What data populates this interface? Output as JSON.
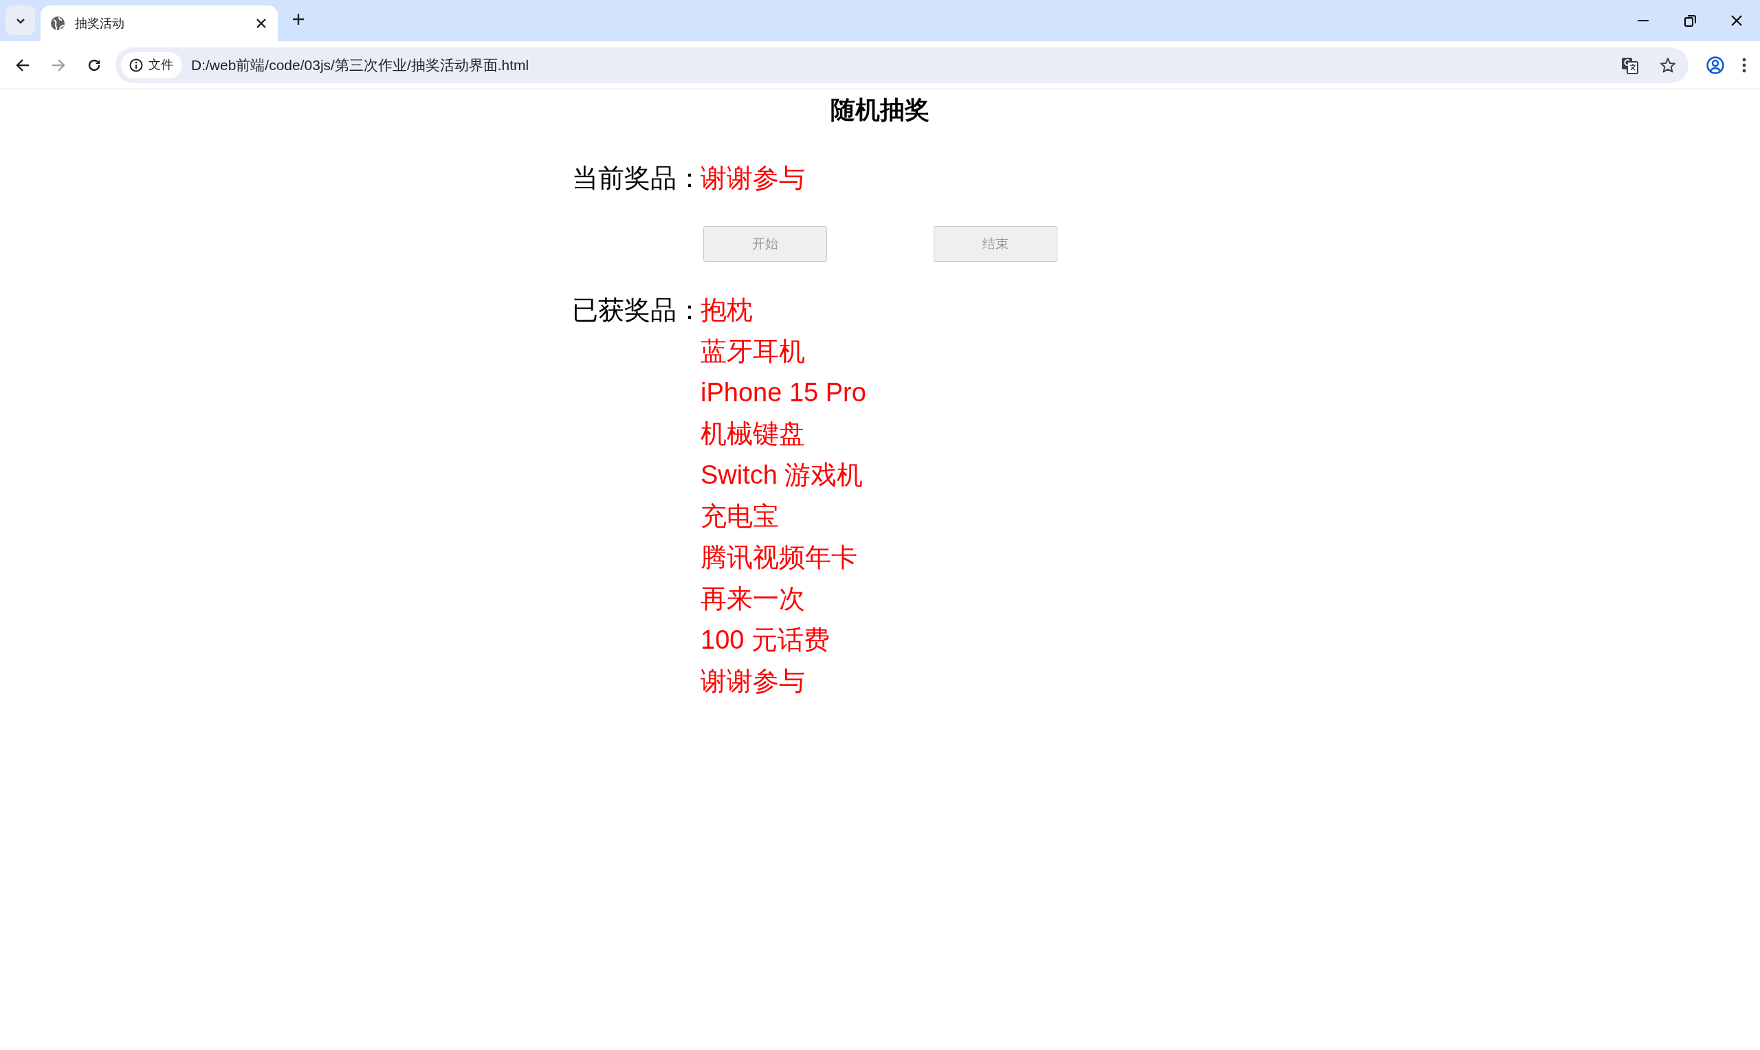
{
  "browser": {
    "tab": {
      "title": "抽奖活动",
      "selected": true
    },
    "security_chip": "文件",
    "url": "D:/web前端/code/03js/第三次作业/抽奖活动界面.html"
  },
  "page": {
    "title": "随机抽奖",
    "current_label": "当前奖品：",
    "current_prize": "谢谢参与",
    "buttons": [
      {
        "label": "开始",
        "disabled": true
      },
      {
        "label": "结束",
        "disabled": true
      }
    ],
    "won_label": "已获奖品：",
    "won_prizes": [
      "抱枕",
      "蓝牙耳机",
      "iPhone 15 Pro",
      "机械键盘",
      "Switch 游戏机",
      "充电宝",
      "腾讯视频年卡",
      "再来一次",
      "100 元话费",
      "谢谢参与"
    ]
  }
}
